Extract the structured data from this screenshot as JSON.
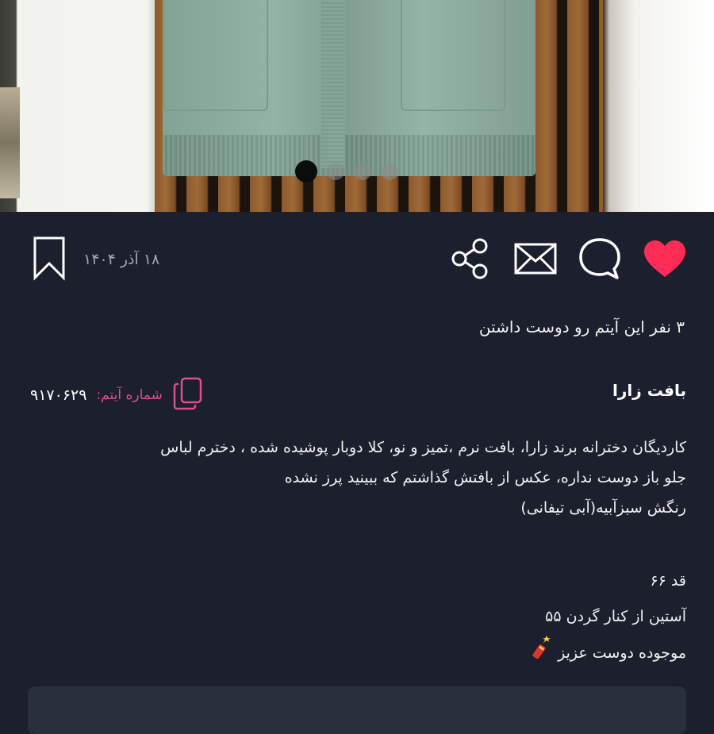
{
  "gallery": {
    "slide_count": 4,
    "active_index": 0
  },
  "actions": {
    "like_icon": "heart-icon",
    "comment_icon": "comment-icon",
    "message_icon": "envelope-icon",
    "share_icon": "share-icon",
    "bookmark_icon": "bookmark-icon",
    "date": "۱۸ آذر ۱۴۰۴",
    "like_color": "#ff2d55"
  },
  "likes_text": "۳ نفر این آیتم رو دوست داشتن",
  "item": {
    "title": "بافت زارا",
    "number_label": "شماره آیتم:",
    "number": "۹۱۷۰۶۲۹",
    "copy_icon": "copy-icon",
    "accent_color": "#e34d8c"
  },
  "description": {
    "line1": "کاردیگان دخترانه برند زارا، بافت نرم ،تمیز و نو، کلا دوبار پوشیده شده ، دخترم لباس",
    "line2": "جلو باز دوست نداره، عکس از بافتش گذاشتم که ببینید پرز نشده",
    "line3": "رنگش سبزآبیه(آبی تیفانی)"
  },
  "details": {
    "size": "قد ۶۶",
    "sleeve": "آستین از کنار گردن ۵۵",
    "availability": "موجوده دوست عزیز"
  }
}
